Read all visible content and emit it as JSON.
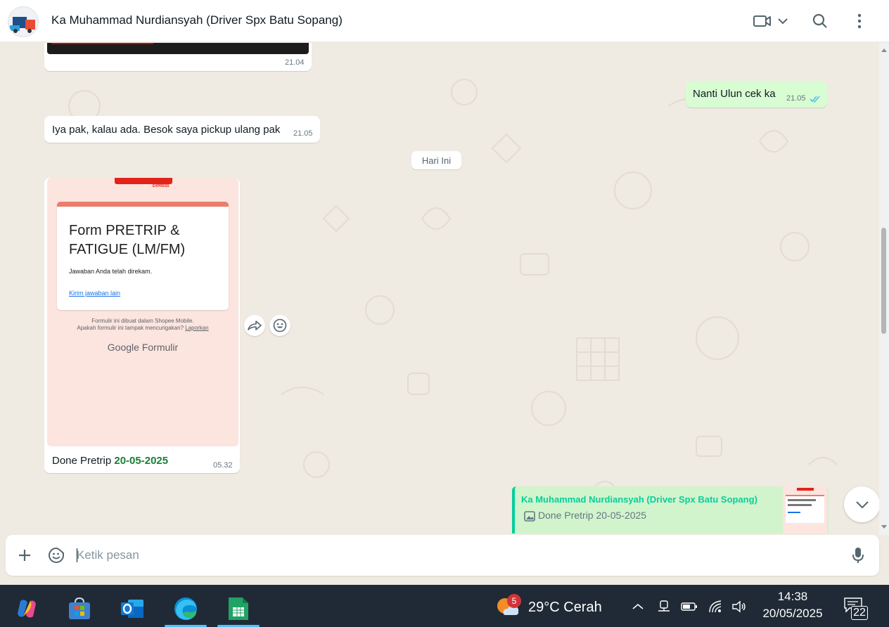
{
  "header": {
    "contact_name": "Ka Muhammad Nurdiansyah (Driver Spx Batu Sopang)",
    "icons": [
      "video-call-icon",
      "chevron-down-icon",
      "search-icon",
      "menu-icon"
    ]
  },
  "chat": {
    "messages": [
      {
        "direction": "in",
        "type": "image",
        "time": "21.04"
      },
      {
        "direction": "out",
        "text": "Nanti Ulun cek ka",
        "time": "21.05",
        "status": "read"
      },
      {
        "direction": "in",
        "text": "Iya pak, kalau ada. Besok saya pickup ulang pak",
        "time": "21.05"
      },
      {
        "direction": "in",
        "type": "image",
        "caption_prefix": "Done Pretrip ",
        "caption_date": "20-05-2025",
        "time": "05.32"
      }
    ],
    "day_separator": "Hari Ini",
    "form_image": {
      "title": "Form PRETRIP & FATIGUE (LM/FM)",
      "response_text": "Jawaban Anda telah direkam.",
      "link_text": "Kirim jawaban lain",
      "footer_line1": "Formulir ini dibuat dalam Shopee Mobile.",
      "footer_line2": "Apakah formulir ini tampak mencurigakan? ",
      "footer_report": "Laporkan",
      "google_logo": "Google",
      "google_product": "Formulir",
      "brand_text": "EXPRESS"
    },
    "reply_quote": {
      "name": "Ka Muhammad Nurdiansyah (Driver Spx Batu Sopang)",
      "text": "Done Pretrip 20-05-2025"
    }
  },
  "composer": {
    "placeholder": "Ketik pesan"
  },
  "taskbar": {
    "weather_badge": "5",
    "weather_text": "29°C  Cerah",
    "time": "14:38",
    "date": "20/05/2025",
    "notification_count": "22",
    "apps": [
      "copilot-icon",
      "microsoft-store-icon",
      "outlook-icon",
      "edge-icon",
      "excel-icon"
    ],
    "active_apps": [
      "edge-icon",
      "excel-icon"
    ]
  },
  "colors": {
    "accent_green": "#06cf9c",
    "date_green": "#1a7f37",
    "outgoing_bubble": "#d9fdd3",
    "chat_background": "#efeae2",
    "read_ticks": "#53bdeb",
    "taskbar": "#1f2a36"
  }
}
